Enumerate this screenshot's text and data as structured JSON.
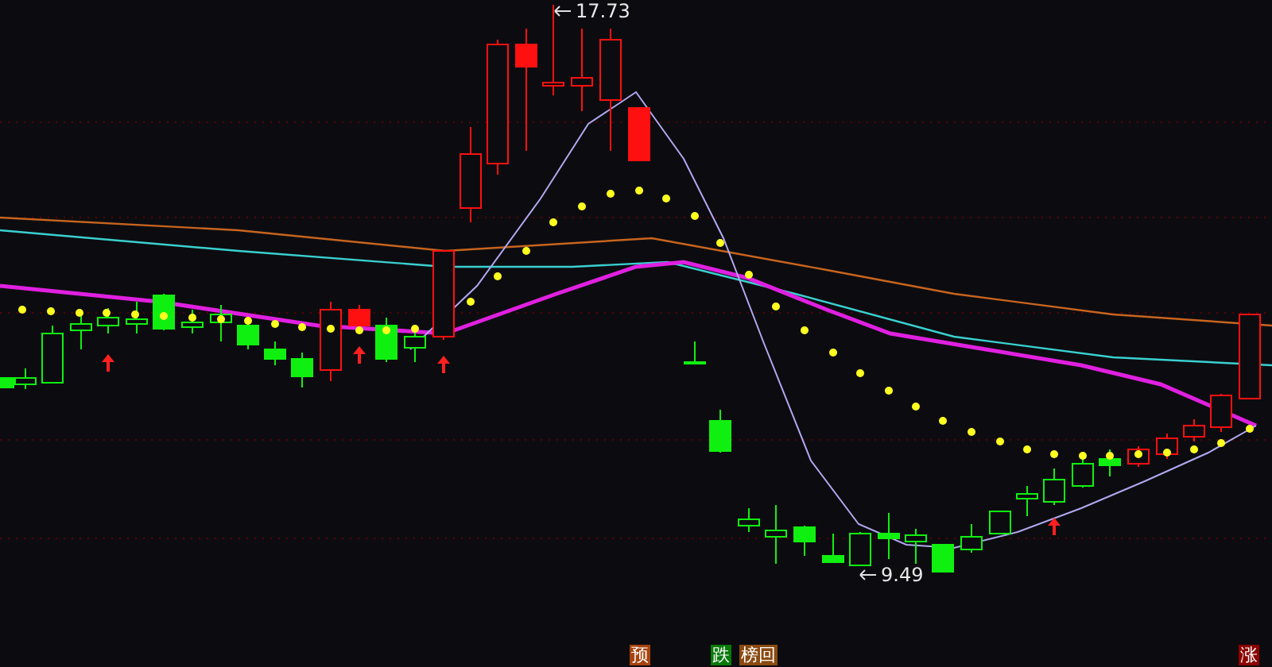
{
  "chart": {
    "high_label": "17.73",
    "low_label": "9.49"
  },
  "markers": [
    {
      "label": "预",
      "color": "#a8430e"
    },
    {
      "label": "跌",
      "color": "#0a7a0a"
    },
    {
      "label": "榜回",
      "color": "#8a4a10"
    },
    {
      "label": "涨",
      "color": "#8c0000"
    }
  ]
}
